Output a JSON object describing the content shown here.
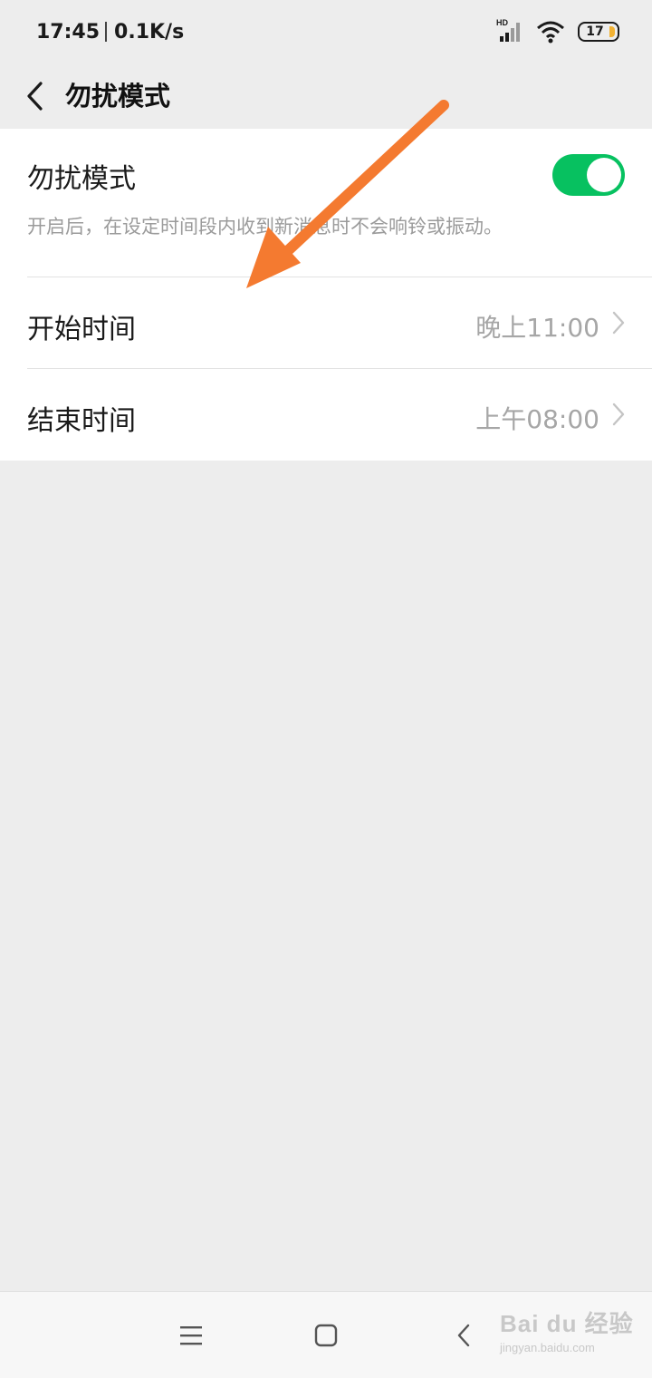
{
  "status_bar": {
    "time": "17:45",
    "network_speed": "0.1K/s",
    "signal_badge": "HD",
    "battery_level": "17",
    "battery_color": "#f2b233"
  },
  "header": {
    "title": "勿扰模式",
    "back_icon": "chevron-left-icon"
  },
  "settings": {
    "dnd": {
      "label": "勿扰模式",
      "description": "开启后，在设定时间段内收到新消息时不会响铃或振动。",
      "enabled": true,
      "toggle_color": "#07c160"
    },
    "start_time": {
      "label": "开始时间",
      "value": "晚上11:00"
    },
    "end_time": {
      "label": "结束时间",
      "value": "上午08:00"
    }
  },
  "nav_bar": {
    "menu_icon": "menu-icon",
    "home_icon": "home-icon",
    "back_icon": "back-icon"
  },
  "watermark": {
    "main": "Bai du 经验",
    "sub": "jingyan.baidu.com"
  },
  "annotation": {
    "arrow_color": "#f47a30",
    "arrow_icon": "arrow-icon"
  }
}
